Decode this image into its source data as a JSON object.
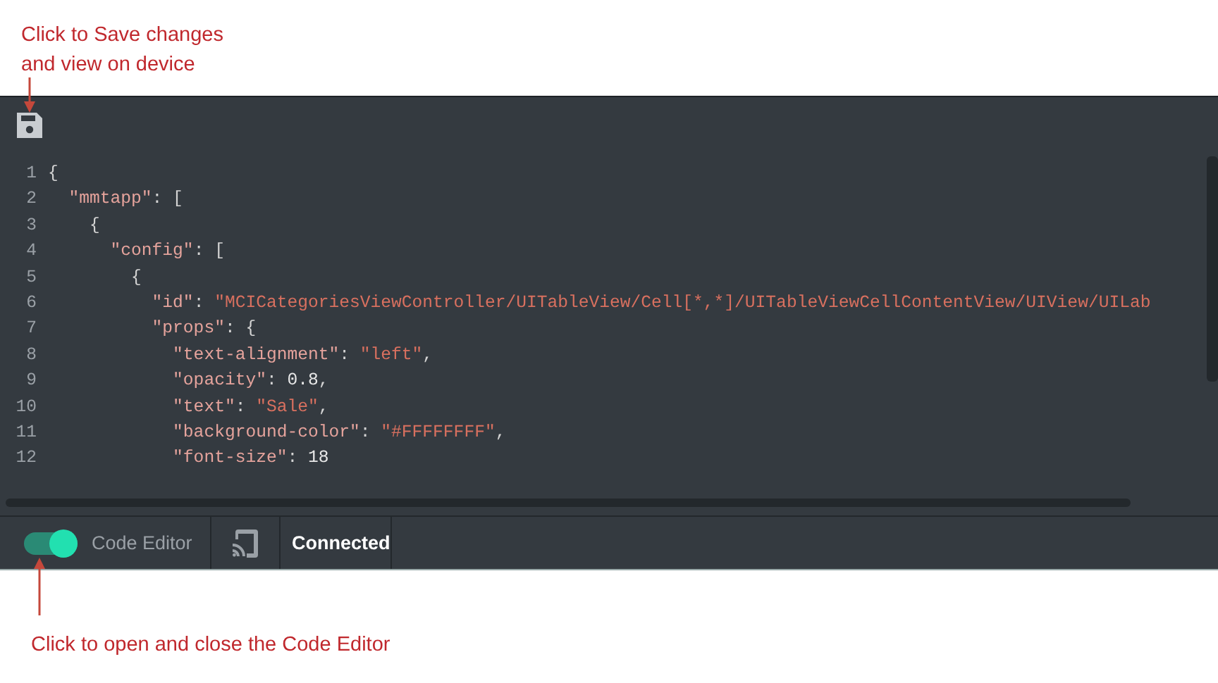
{
  "callouts": [
    {
      "kind": "top",
      "text": "Click to Save changes\nand view on device"
    },
    {
      "kind": "bottom",
      "text": "Click to open and close the Code Editor"
    }
  ],
  "editor": {
    "lines": [
      {
        "number": "1",
        "tokens": [
          {
            "kind": "punct",
            "text": "{"
          }
        ]
      },
      {
        "number": "2",
        "tokens": [
          {
            "kind": "key",
            "text": "  \"mmtapp\""
          },
          {
            "kind": "punct",
            "text": ": ["
          }
        ]
      },
      {
        "number": "3",
        "tokens": [
          {
            "kind": "punct",
            "text": "    {"
          }
        ]
      },
      {
        "number": "4",
        "tokens": [
          {
            "kind": "key",
            "text": "      \"config\""
          },
          {
            "kind": "punct",
            "text": ": ["
          }
        ]
      },
      {
        "number": "5",
        "tokens": [
          {
            "kind": "punct",
            "text": "        {"
          }
        ]
      },
      {
        "number": "6",
        "tokens": [
          {
            "kind": "key",
            "text": "          \"id\""
          },
          {
            "kind": "punct",
            "text": ": "
          },
          {
            "kind": "string",
            "text": "\"MCICategoriesViewController/UITableView/Cell[*,*]/UITableViewCellContentView/UIView/UILab"
          }
        ]
      },
      {
        "number": "7",
        "tokens": [
          {
            "kind": "key",
            "text": "          \"props\""
          },
          {
            "kind": "punct",
            "text": ": {"
          }
        ]
      },
      {
        "number": "8",
        "tokens": [
          {
            "kind": "key",
            "text": "            \"text-alignment\""
          },
          {
            "kind": "punct",
            "text": ": "
          },
          {
            "kind": "string",
            "text": "\"left\""
          },
          {
            "kind": "punct",
            "text": ","
          }
        ]
      },
      {
        "number": "9",
        "tokens": [
          {
            "kind": "key",
            "text": "            \"opacity\""
          },
          {
            "kind": "punct",
            "text": ": "
          },
          {
            "kind": "number",
            "text": "0.8"
          },
          {
            "kind": "punct",
            "text": ","
          }
        ]
      },
      {
        "number": "10",
        "tokens": [
          {
            "kind": "key",
            "text": "            \"text\""
          },
          {
            "kind": "punct",
            "text": ": "
          },
          {
            "kind": "string",
            "text": "\"Sale\""
          },
          {
            "kind": "punct",
            "text": ","
          }
        ]
      },
      {
        "number": "11",
        "tokens": [
          {
            "kind": "key",
            "text": "            \"background-color\""
          },
          {
            "kind": "punct",
            "text": ": "
          },
          {
            "kind": "string",
            "text": "\"#FFFFFFFF\""
          },
          {
            "kind": "punct",
            "text": ","
          }
        ]
      },
      {
        "number": "12",
        "tokens": [
          {
            "kind": "key",
            "text": "            \"font-size\""
          },
          {
            "kind": "punct",
            "text": ": "
          },
          {
            "kind": "number",
            "text": "18"
          }
        ]
      }
    ]
  },
  "status_bar": {
    "toggle": {
      "label": "Code Editor",
      "on": true
    },
    "status": "Connected"
  }
}
